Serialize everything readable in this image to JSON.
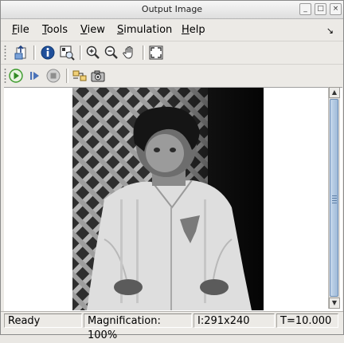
{
  "window": {
    "title": "Output Image"
  },
  "titlebar_buttons": [
    "_",
    "□",
    "×"
  ],
  "menu": {
    "items": [
      {
        "accel": "F",
        "rest": "ile"
      },
      {
        "accel": "T",
        "rest": "ools"
      },
      {
        "accel": "V",
        "rest": "iew"
      },
      {
        "accel": "S",
        "rest": "imulation"
      },
      {
        "accel": "H",
        "rest": "elp"
      }
    ],
    "dock_arrow": "↘"
  },
  "toolbar1": {
    "icons": [
      "export-to-workspace-icon",
      "info-icon",
      "pixel-region-icon",
      "zoom-in-icon",
      "zoom-out-icon",
      "pan-hand-icon",
      "fit-to-window-icon"
    ]
  },
  "toolbar2": {
    "icons": [
      "play-icon",
      "step-forward-icon",
      "stop-icon",
      "highlight-block-icon",
      "snapshot-camera-icon"
    ]
  },
  "status": {
    "state": "Ready",
    "magnification": "Magnification: 100%",
    "image_info": "I:291x240",
    "time": "T=10.000"
  },
  "colors": {
    "play_green": "#3a9a2a",
    "step_blue": "#4a72b8",
    "stop_gray": "#8e8e8e",
    "scroll_thumb": "#a9c1dd"
  }
}
